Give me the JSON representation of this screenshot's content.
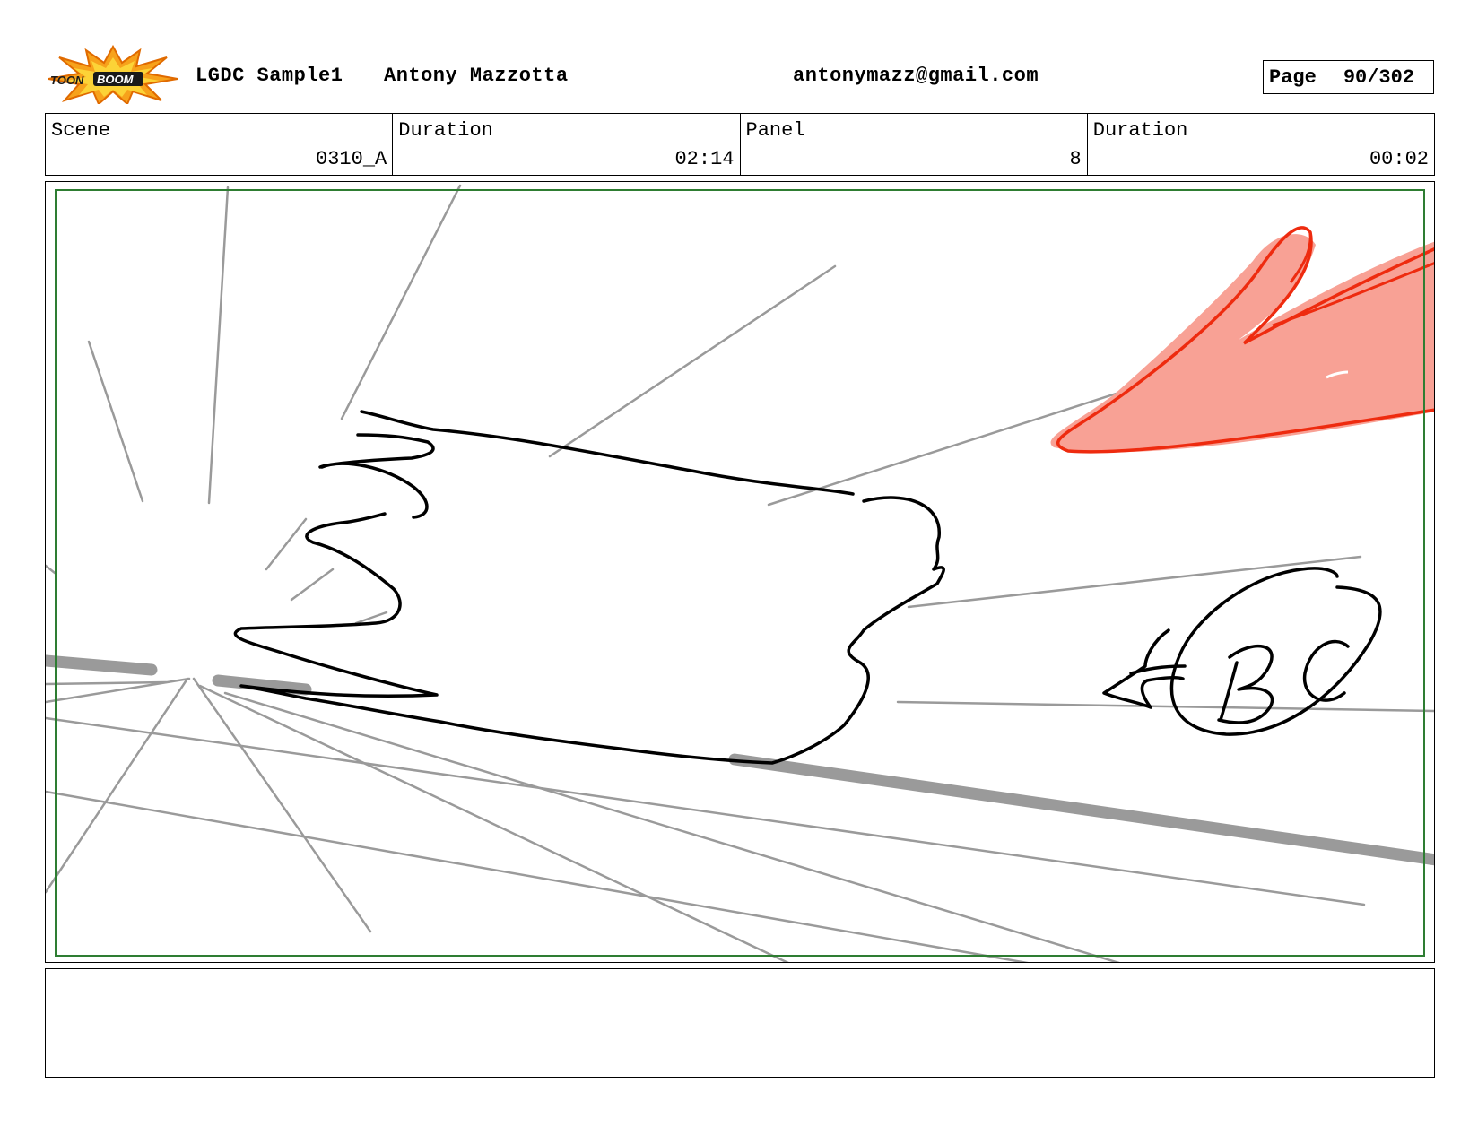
{
  "header": {
    "logo_text": "TOONBOOM",
    "project": "LGDC Sample1",
    "author": "Antony Mazzotta",
    "email": "antonymazz@gmail.com",
    "page_label": "Page",
    "page_number": "90/302"
  },
  "info": {
    "scene_label": "Scene",
    "scene_value": "0310_A",
    "scene_duration_label": "Duration",
    "scene_duration_value": "02:14",
    "panel_label": "Panel",
    "panel_value": "8",
    "panel_duration_label": "Duration",
    "panel_duration_value": "00:02"
  },
  "panel": {
    "annotation_text": "BG",
    "colors": {
      "safe_frame": "#2e7d32",
      "red_accent": "#ee2b0f",
      "red_fill": "#f8a195",
      "speed_lines": "#9a9a9a"
    }
  },
  "notes": {
    "text": ""
  }
}
